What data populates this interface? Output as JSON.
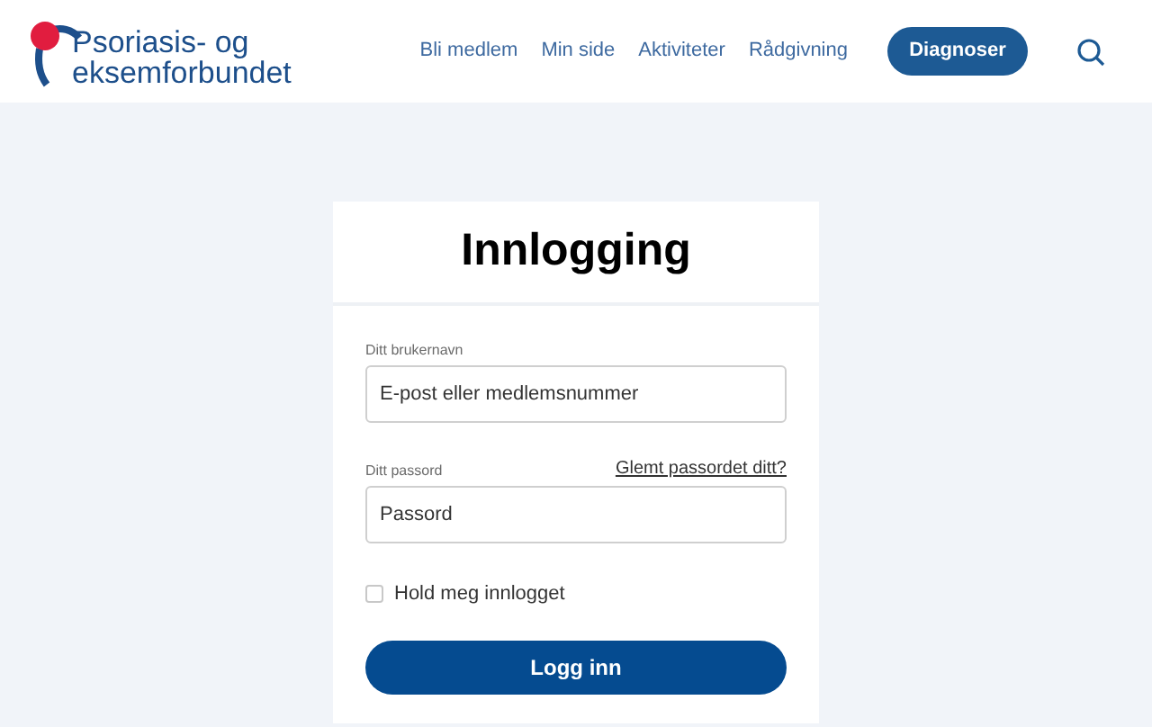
{
  "header": {
    "logo_text": [
      "Psoriasis- og",
      "eksemforbundet"
    ],
    "nav": [
      "Bli medlem",
      "Min side",
      "Aktiviteter",
      "Rådgivning"
    ],
    "cta": "Diagnoser"
  },
  "login": {
    "title": "Innlogging",
    "username": {
      "label": "Ditt brukernavn",
      "placeholder": "E-post eller medlemsnummer"
    },
    "password": {
      "label": "Ditt passord",
      "forgot": "Glemt passordet ditt?",
      "placeholder": "Passord"
    },
    "remember": {
      "label": "Hold meg innlogget",
      "checked": false
    },
    "submit": "Logg inn"
  }
}
